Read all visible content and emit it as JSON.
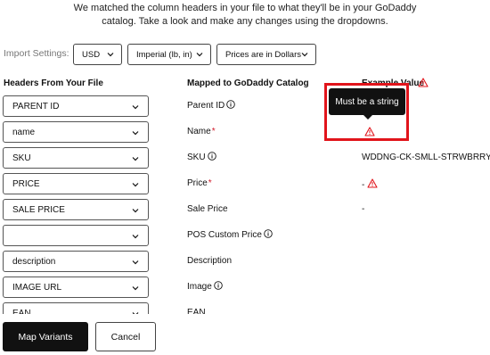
{
  "intro": {
    "line1": "We matched the column headers in your file to what they'll be in your GoDaddy",
    "line2": "catalog. Take a look and make any changes using the dropdowns."
  },
  "import_settings": {
    "label": "Import Settings:",
    "currency": "USD",
    "units": "Imperial (lb, in)",
    "prices": "Prices are in Dollars"
  },
  "headers": {
    "from_file": "Headers From Your File",
    "mapped_to": "Mapped to GoDaddy Catalog",
    "sample_value": "Example Value"
  },
  "tooltip": {
    "text": "Must be a string"
  },
  "rows": [
    {
      "file_header": "PARENT ID",
      "mapped": "Parent ID",
      "required": false,
      "info": true,
      "sample": "",
      "warning": false
    },
    {
      "file_header": "name",
      "mapped": "Name",
      "required": true,
      "info": false,
      "sample": "",
      "warning": true
    },
    {
      "file_header": "SKU",
      "mapped": "SKU",
      "required": false,
      "info": true,
      "sample": "WDDNG-CK-SMLL-STRWBRRY,,F",
      "warning": false
    },
    {
      "file_header": "PRICE",
      "mapped": "Price",
      "required": true,
      "info": false,
      "sample": "-",
      "warning": true
    },
    {
      "file_header": "SALE PRICE",
      "mapped": "Sale Price",
      "required": false,
      "info": false,
      "sample": "-",
      "warning": false
    },
    {
      "file_header": "",
      "mapped": "POS Custom Price",
      "required": false,
      "info": true,
      "sample": "",
      "warning": false
    },
    {
      "file_header": "description",
      "mapped": "Description",
      "required": false,
      "info": false,
      "sample": "",
      "warning": false
    },
    {
      "file_header": "IMAGE URL",
      "mapped": "Image",
      "required": false,
      "info": true,
      "sample": "",
      "warning": false
    },
    {
      "file_header": "EAN",
      "mapped": "EAN",
      "required": false,
      "info": false,
      "sample": "",
      "warning": false
    }
  ],
  "required_marker": "*",
  "buttons": {
    "map_variants": "Map Variants",
    "cancel": "Cancel"
  },
  "colors": {
    "primary": "#111111",
    "warning": "#e1141b",
    "required": "#d11a2a",
    "muted": "#777777"
  },
  "icons": {
    "dropdown": "chevron-down-icon",
    "info": "info-icon",
    "warning": "warning-triangle-icon"
  }
}
